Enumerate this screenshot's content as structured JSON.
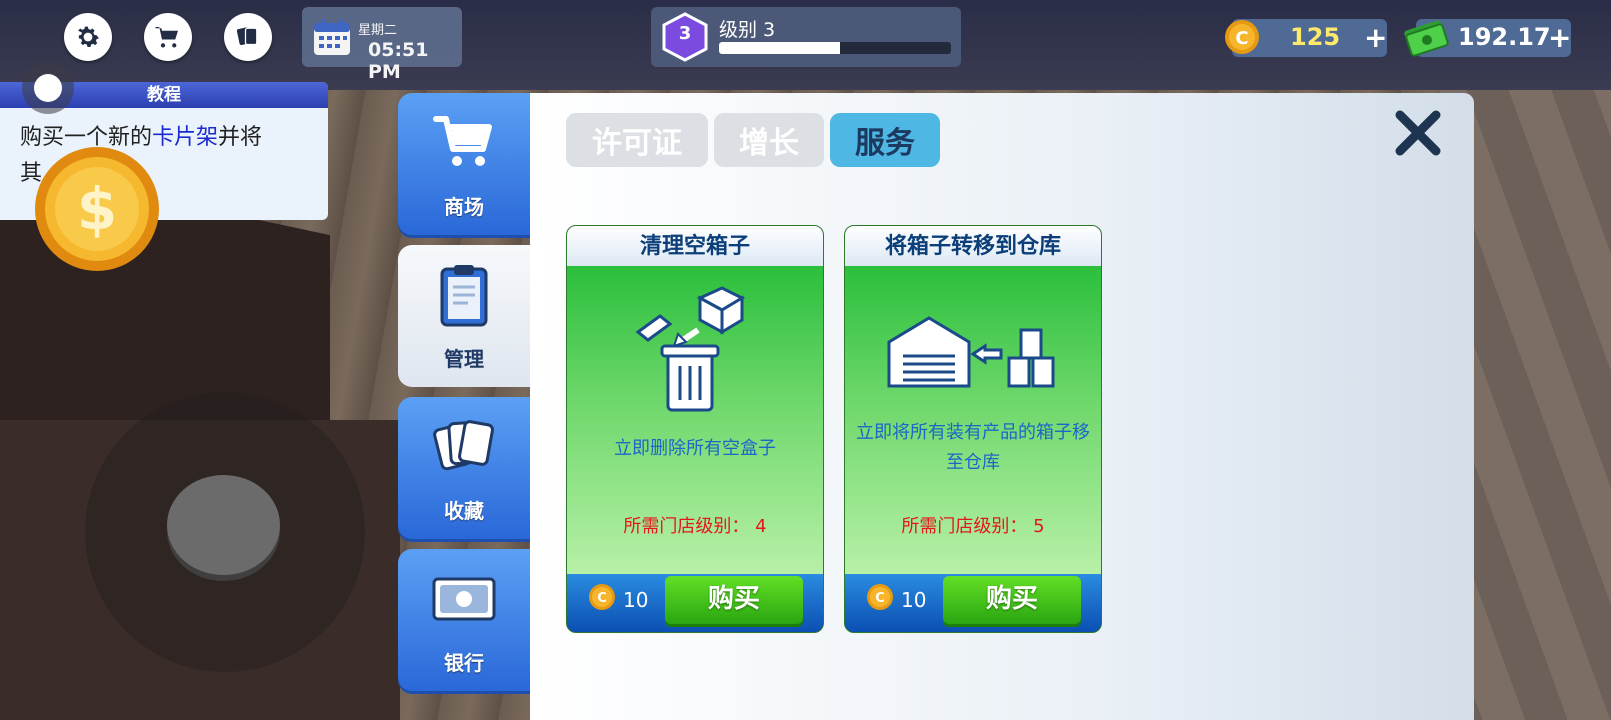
{
  "hud": {
    "weekday": "星期二",
    "time": "05:51 PM",
    "level_num": "3",
    "level_label": "级别 3",
    "level_progress": 0.52,
    "coins": "125",
    "cash": "192.17",
    "plus": "+"
  },
  "tutorial": {
    "title": "教程",
    "text_a": "购买一个新的",
    "text_highlight": "卡片架",
    "text_b": "并将",
    "text_c": "其"
  },
  "side_tabs": [
    {
      "label": "商场",
      "icon": "cart-icon"
    },
    {
      "label": "管理",
      "icon": "clipboard-icon"
    },
    {
      "label": "收藏",
      "icon": "cards-icon"
    },
    {
      "label": "银行",
      "icon": "banknote-icon"
    }
  ],
  "tabs": [
    "许可证",
    "增长",
    "服务"
  ],
  "active_tab": "服务",
  "cards": [
    {
      "title": "清理空箱子",
      "desc": "立即删除所有空盒子",
      "req": "所需门店级别： 4",
      "price": "10",
      "buy": "购买"
    },
    {
      "title": "将箱子转移到仓库",
      "desc": "立即将所有装有产品的箱子移至仓库",
      "req": "所需门店级别： 5",
      "price": "10",
      "buy": "购买"
    }
  ],
  "colors": {
    "tab_active": "#4fb7e3",
    "buy_green": "#3ec11a",
    "requirement_red": "#e41818",
    "coin_text": "#ffe96b"
  }
}
